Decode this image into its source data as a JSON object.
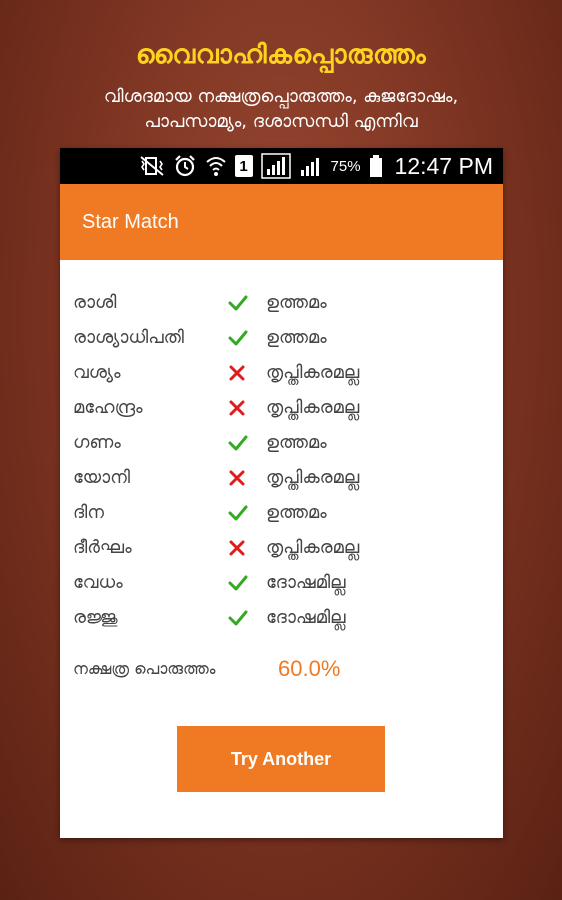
{
  "promo": {
    "title": "വൈവാഹികപ്പൊരുത്തം",
    "subtitle_line1": "വിശദമായ നക്ഷത്രപ്പൊരുത്തം, കുജദോഷം,",
    "subtitle_line2": "പാപസാമ്യം, ദശാസന്ധി എന്നിവ"
  },
  "status_bar": {
    "sim_slot": "1",
    "battery_percent": "75%",
    "time": "12:47 PM",
    "icons": [
      "mute-vibrate-icon",
      "alarm-icon",
      "wifi-icon",
      "sim-icon",
      "signal-icon",
      "signal-icon",
      "battery-icon"
    ]
  },
  "app_bar": {
    "title": "Star Match"
  },
  "colors": {
    "accent": "#f07a23",
    "check": "#33aa22",
    "cross": "#e01b1b"
  },
  "matches": [
    {
      "name": "രാശി",
      "ok": true,
      "result": "ഉത്തമം"
    },
    {
      "name": "രാശ്യാധിപതി",
      "ok": true,
      "result": "ഉത്തമം"
    },
    {
      "name": "വശ്യം",
      "ok": false,
      "result": "തൃപ്തികരമല്ല"
    },
    {
      "name": "മഹേന്ദ്രം",
      "ok": false,
      "result": "തൃപ്തികരമല്ല"
    },
    {
      "name": "ഗണം",
      "ok": true,
      "result": "ഉത്തമം"
    },
    {
      "name": "യോനി",
      "ok": false,
      "result": "തൃപ്തികരമല്ല"
    },
    {
      "name": "ദിന",
      "ok": true,
      "result": "ഉത്തമം"
    },
    {
      "name": "ദീർഘം",
      "ok": false,
      "result": "തൃപ്തികരമല്ല"
    },
    {
      "name": "വേധം",
      "ok": true,
      "result": "ദോഷമില്ല"
    },
    {
      "name": "രജ്ജു",
      "ok": true,
      "result": "ദോഷമില്ല"
    }
  ],
  "summary": {
    "label": "നക്ഷത്ര പൊരുത്തം",
    "value": "60.0%"
  },
  "actions": {
    "try_another": "Try Another"
  }
}
